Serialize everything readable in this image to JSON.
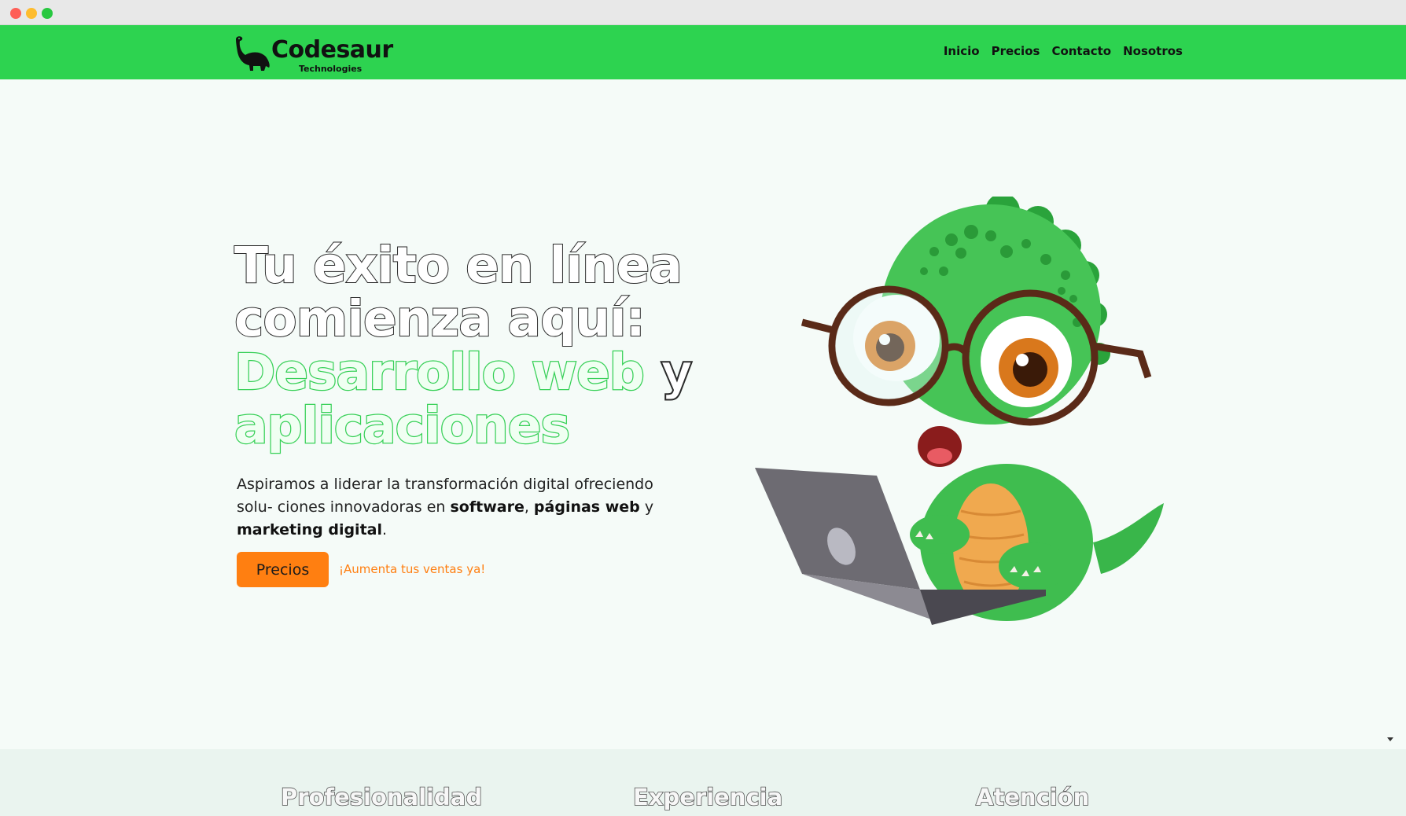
{
  "brand": {
    "name": "Codesaur",
    "tagline": "Technologies",
    "logo_icon": "dinosaur-icon"
  },
  "nav": {
    "items": [
      {
        "label": "Inicio"
      },
      {
        "label": "Precios"
      },
      {
        "label": "Contacto"
      },
      {
        "label": "Nosotros"
      }
    ]
  },
  "hero": {
    "title_line1": "Tu éxito en línea",
    "title_line2": "comienza aquí:",
    "title_green1": "Desarrollo web",
    "title_and": " y",
    "title_green2": "aplicaciones",
    "desc_part1": "Aspiramos a liderar la transformación digital ofreciendo solu- ciones innovadoras en ",
    "desc_bold1": "software",
    "desc_sep1": ", ",
    "desc_bold2": "páginas web",
    "desc_sep2": " y ",
    "desc_bold3": "marketing digital",
    "desc_end": ".",
    "button_label": "Precios",
    "cta_text": "¡Aumenta tus ventas ya!",
    "illustration": "dinosaur-with-laptop"
  },
  "features": {
    "items": [
      {
        "label": "Profesionalidad"
      },
      {
        "label": "Experiencia"
      },
      {
        "label": "Atención"
      }
    ]
  },
  "colors": {
    "nav_bg": "#2dd350",
    "accent_orange": "#ff7f11",
    "green_text": "#36d056",
    "page_bg": "#f5fbf8"
  }
}
